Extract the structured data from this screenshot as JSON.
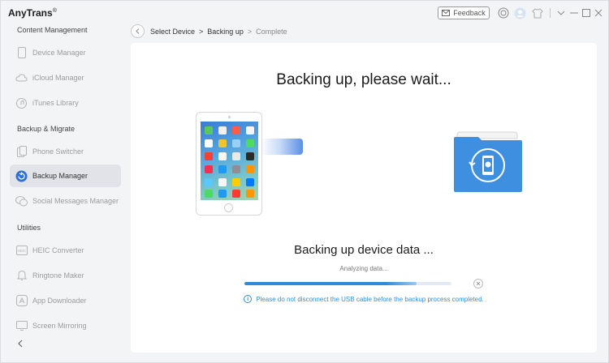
{
  "app": {
    "title": "AnyTrans",
    "trademark": "®"
  },
  "titlebar": {
    "feedback_label": "Feedback"
  },
  "sidebar": {
    "sections": [
      {
        "title": "Content Management",
        "items": [
          {
            "label": "Device Manager",
            "icon": "device-icon"
          },
          {
            "label": "iCloud Manager",
            "icon": "cloud-icon"
          },
          {
            "label": "iTunes Library",
            "icon": "music-icon"
          }
        ]
      },
      {
        "title": "Backup & Migrate",
        "items": [
          {
            "label": "Phone Switcher",
            "icon": "phone-switch-icon"
          },
          {
            "label": "Backup Manager",
            "icon": "backup-icon",
            "active": true
          },
          {
            "label": "Social Messages Manager",
            "icon": "chat-icon"
          }
        ]
      },
      {
        "title": "Utilities",
        "items": [
          {
            "label": "HEIC Converter",
            "icon": "heic-icon"
          },
          {
            "label": "Ringtone Maker",
            "icon": "bell-icon"
          },
          {
            "label": "App Downloader",
            "icon": "app-store-icon"
          },
          {
            "label": "Screen Mirroring",
            "icon": "mirror-icon"
          }
        ]
      }
    ]
  },
  "breadcrumb": {
    "step1": "Select Device",
    "sep": ">",
    "step2": "Backing up",
    "step3": "Complete"
  },
  "main": {
    "headline": "Backing up, please wait...",
    "status_title": "Backing up device data ...",
    "status_sub": "Analyzing data...",
    "progress": 0.83,
    "notice": "Please do not disconnect the USB cable before the backup process completed."
  },
  "colors": {
    "accent": "#2e8ad8",
    "folder": "#3f8fe0",
    "active_item_bg": "#e1e3e8"
  }
}
